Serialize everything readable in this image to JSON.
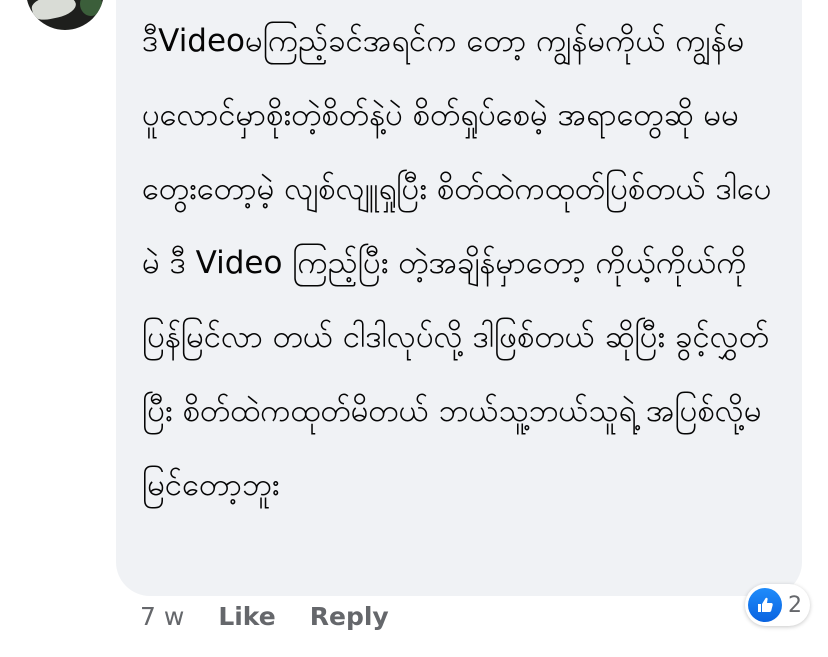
{
  "comment": {
    "text": "ဒီVideoမကြည့်ခင်အရင်က တော့ ကျွန်မကိုယ် ကျွန်မ ပူလောင်မှာစိုးတဲ့စိတ်နဲ့ပဲ စိတ်ရှုပ်စေမဲ့ အရာတွေဆို မမတွေးတော့မဲ့ လျစ်လျူရှုပြီး စိတ်ထဲကထုတ်ပြစ်တယ်  ဒါပေမဲ ဒီ Video ကြည့်ပြီး တဲ့အချိန်မှာတော့ ကိုယ့်ကိုယ်ကို ပြန်မြင်လာ တယ် ငါဒါလုပ်လို့ ဒါဖြစ်တယ် ဆိုပြီး ခွင့်လွှတ် ပြီး စိတ်ထဲကထုတ်မိတယ် ဘယ်သူ့ဘယ်သူရဲ့ အပြစ်လို့မမြင်တော့ဘူး"
  },
  "meta": {
    "time": "7 w",
    "like_label": "Like",
    "reply_label": "Reply"
  },
  "reactions": {
    "icon": "like-thumb-icon",
    "count": "2"
  },
  "colors": {
    "bubble_bg": "#f0f2f5",
    "text": "#050505",
    "meta_text": "#65676b",
    "like_blue": "#0a63e0"
  }
}
